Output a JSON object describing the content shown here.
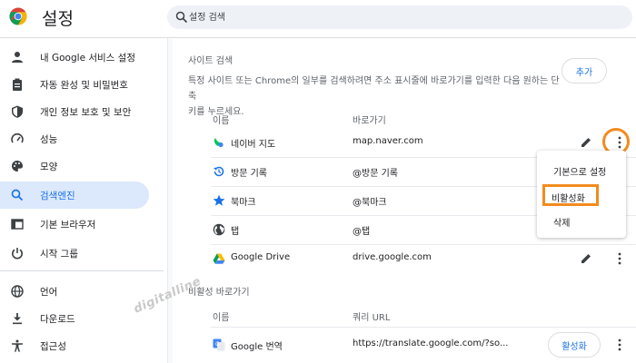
{
  "app": {
    "title": "설정"
  },
  "search": {
    "placeholder": "설정 검색"
  },
  "sidebar": {
    "items": [
      {
        "label": "내 Google 서비스 설정",
        "icon": "person-icon",
        "active": false
      },
      {
        "label": "자동 완성 및 비밀번호",
        "icon": "clipboard-icon",
        "active": false
      },
      {
        "label": "개인 정보 보호 및 보안",
        "icon": "shield-icon",
        "active": false
      },
      {
        "label": "성능",
        "icon": "speedometer-icon",
        "active": false
      },
      {
        "label": "모양",
        "icon": "palette-icon",
        "active": false
      },
      {
        "label": "검색엔진",
        "icon": "search-icon",
        "active": true
      },
      {
        "label": "기본 브라우저",
        "icon": "browser-icon",
        "active": false
      },
      {
        "label": "시작 그룹",
        "icon": "power-icon",
        "active": false
      },
      {
        "label": "언어",
        "icon": "globe-icon",
        "active": false
      },
      {
        "label": "다운로드",
        "icon": "download-icon",
        "active": false
      },
      {
        "label": "접근성",
        "icon": "accessibility-icon",
        "active": false
      }
    ]
  },
  "site_search": {
    "title": "사이트 검색",
    "desc_line1": "특정 사이트 또는 Chrome의 일부를 검색하려면 주소 표시줄에 바로가기를 입력한 다음 원하는 단축",
    "desc_line2": "키를 누르세요.",
    "add_label": "추가",
    "col_name": "이름",
    "col_shortcut": "바로가기",
    "rows": [
      {
        "name": "네이버 지도",
        "shortcut": "map.naver.com",
        "icon": "naver-map-icon"
      },
      {
        "name": "방문 기록",
        "shortcut": "@방문 기록",
        "icon": "history-icon"
      },
      {
        "name": "북마크",
        "shortcut": "@북마크",
        "icon": "star-icon"
      },
      {
        "name": "탭",
        "shortcut": "@탭",
        "icon": "globe-icon"
      },
      {
        "name": "Google Drive",
        "shortcut": "drive.google.com",
        "icon": "google-drive-icon"
      }
    ]
  },
  "inactive": {
    "title": "비활성 바로가기",
    "col_name": "이름",
    "col_url": "쿼리 URL",
    "rows": [
      {
        "name": "Google 번역",
        "url": "https://translate.google.com/?so...",
        "action": "활성화",
        "icon": "google-translate-icon"
      }
    ]
  },
  "menu": {
    "items": [
      "기본으로 설정",
      "비활성화",
      "삭제"
    ]
  },
  "watermark": "digitalline",
  "colors": {
    "accent": "#1a73e8",
    "active_bg": "#dce8fb",
    "highlight": "#f28b1d"
  }
}
